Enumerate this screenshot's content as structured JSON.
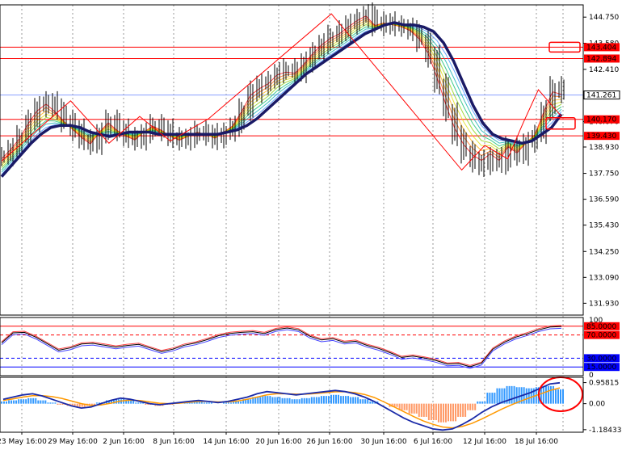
{
  "chart_data": {
    "type": "line",
    "title": "",
    "x_labels": [
      "23 May 16:00",
      "29 May 16:00",
      "2 Jun 16:00",
      "8 Jun 16:00",
      "14 Jun 16:00",
      "20 Jun 16:00",
      "26 Jun 16:00",
      "30 Jun 16:00",
      "6 Jul 16:00",
      "12 Jul 16:00",
      "18 Jul 16:00"
    ],
    "price_panel": {
      "ylim": [
        131.4,
        145.3
      ],
      "tick_labels": [
        "144.750",
        "143.580",
        "142.410",
        "141.240",
        "140.070",
        "138.930",
        "137.750",
        "136.590",
        "135.430",
        "134.250",
        "133.090",
        "131.930"
      ],
      "ticks": [
        144.75,
        143.58,
        142.41,
        141.24,
        140.07,
        138.93,
        137.75,
        136.59,
        135.43,
        134.25,
        133.09,
        131.93
      ],
      "level_lines": [
        {
          "value": 143.404,
          "label": "143.404",
          "color": "#ff0000"
        },
        {
          "value": 142.894,
          "label": "142.894",
          "color": "#ff0000"
        },
        {
          "value": 140.17,
          "label": "140.170",
          "color": "#ff0000"
        },
        {
          "value": 139.43,
          "label": "139.430",
          "color": "#ff0000"
        }
      ],
      "current_price": {
        "value": 141.261,
        "label": "141.261"
      },
      "close_series": [
        138.5,
        138.9,
        139.4,
        140.1,
        140.7,
        141.0,
        140.6,
        140.1,
        139.7,
        139.3,
        139.0,
        139.6,
        140.1,
        139.7,
        139.4,
        139.2,
        139.6,
        139.9,
        139.7,
        139.4,
        139.2,
        139.4,
        139.6,
        139.5,
        139.3,
        139.6,
        139.9,
        140.6,
        141.4,
        141.7,
        141.9,
        142.3,
        142.4,
        142.3,
        142.7,
        143.2,
        143.6,
        143.9,
        144.1,
        144.4,
        144.7,
        144.9,
        144.4,
        144.5,
        144.4,
        144.3,
        144.1,
        143.7,
        143.0,
        141.8,
        140.5,
        139.4,
        138.7,
        138.3,
        138.1,
        138.5,
        138.2,
        138.9,
        138.6,
        139.1,
        139.5,
        140.6,
        141.6,
        141.4
      ],
      "slow_ma_series": [
        137.6,
        138.1,
        138.6,
        139.1,
        139.5,
        139.8,
        139.9,
        139.9,
        139.8,
        139.6,
        139.5,
        139.4,
        139.5,
        139.6,
        139.6,
        139.6,
        139.5,
        139.5,
        139.5,
        139.5,
        139.5,
        139.5,
        139.5,
        139.6,
        139.7,
        139.9,
        140.2,
        140.6,
        141.0,
        141.4,
        141.8,
        142.2,
        142.5,
        142.8,
        143.1,
        143.4,
        143.7,
        144.0,
        144.2,
        144.4,
        144.5,
        144.4,
        144.4,
        144.3,
        144.1,
        143.6,
        142.8,
        141.8,
        140.8,
        140.0,
        139.5,
        139.3,
        139.2,
        139.1,
        139.2,
        139.5,
        139.8,
        140.4
      ]
    },
    "rsi_panel": {
      "ylim": [
        0,
        100
      ],
      "tick_labels": [
        "100",
        "85.0000",
        "70.0000",
        "30.0000",
        "15.0000",
        "0"
      ],
      "levels": [
        {
          "value": 85,
          "label": "85.0000",
          "color": "#ff0000"
        },
        {
          "value": 70,
          "label": "70.0000",
          "color": "#ff0000"
        },
        {
          "value": 30,
          "label": "30.0000",
          "color": "#0000ff"
        },
        {
          "value": 15,
          "label": "15.0000",
          "color": "#0000ff"
        }
      ],
      "series": [
        60,
        70,
        72,
        65,
        55,
        45,
        50,
        58,
        52,
        50,
        48,
        52,
        55,
        50,
        45,
        42,
        50,
        55,
        62,
        70,
        75,
        78,
        72,
        70,
        78,
        82,
        80,
        70,
        65,
        60,
        55,
        58,
        52,
        48,
        42,
        35,
        30,
        28,
        25,
        20,
        22,
        18,
        25,
        42,
        55,
        65,
        72,
        80,
        86,
        88
      ]
    },
    "macd_panel": {
      "ylim": [
        -1.3,
        1.2
      ],
      "tick_labels": [
        "0.95815",
        "0.00",
        "-1.18433"
      ],
      "ticks": [
        0.95815,
        0,
        -1.18433
      ],
      "histogram": [
        0.1,
        0.15,
        0.2,
        0.25,
        0.15,
        0.05,
        -0.05,
        -0.1,
        -0.15,
        -0.1,
        0.05,
        0.15,
        0.2,
        0.15,
        0.05,
        -0.05,
        -0.1,
        -0.05,
        0,
        0.05,
        0.1,
        0.05,
        0,
        0.05,
        0.1,
        0.2,
        0.3,
        0.35,
        0.3,
        0.25,
        0.2,
        0.25,
        0.3,
        0.35,
        0.4,
        0.35,
        0.3,
        0.2,
        0.1,
        0,
        -0.15,
        -0.3,
        -0.45,
        -0.6,
        -0.75,
        -0.85,
        -0.8,
        -0.6,
        -0.3,
        0.1,
        0.5,
        0.7,
        0.8,
        0.75,
        0.7,
        0.75,
        0.8,
        0.65
      ],
      "macd_line": [
        0.2,
        0.3,
        0.4,
        0.45,
        0.35,
        0.2,
        0.05,
        -0.1,
        -0.2,
        -0.15,
        0,
        0.15,
        0.25,
        0.2,
        0.1,
        0,
        -0.05,
        0,
        0.05,
        0.1,
        0.15,
        0.1,
        0.05,
        0.1,
        0.2,
        0.3,
        0.45,
        0.55,
        0.5,
        0.45,
        0.4,
        0.45,
        0.5,
        0.55,
        0.6,
        0.55,
        0.45,
        0.3,
        0.1,
        -0.15,
        -0.4,
        -0.65,
        -0.85,
        -1.0,
        -1.15,
        -1.2,
        -1.15,
        -0.95,
        -0.7,
        -0.4,
        -0.15,
        0.05,
        0.2,
        0.35,
        0.5,
        0.7,
        0.9,
        0.95
      ],
      "signal_line": [
        0.15,
        0.22,
        0.3,
        0.36,
        0.36,
        0.32,
        0.24,
        0.12,
        0.0,
        -0.08,
        -0.06,
        0.02,
        0.12,
        0.16,
        0.14,
        0.08,
        0.02,
        0.0,
        0.02,
        0.06,
        0.1,
        0.1,
        0.08,
        0.08,
        0.12,
        0.2,
        0.3,
        0.4,
        0.45,
        0.45,
        0.43,
        0.43,
        0.46,
        0.5,
        0.54,
        0.55,
        0.5,
        0.42,
        0.28,
        0.08,
        -0.14,
        -0.36,
        -0.58,
        -0.78,
        -0.94,
        -1.06,
        -1.1,
        -1.04,
        -0.9,
        -0.7,
        -0.48,
        -0.26,
        -0.06,
        0.12,
        0.28,
        0.44,
        0.6,
        0.72
      ]
    }
  },
  "colors": {
    "price_bars": "#000000",
    "bull_pivot_line": "#ff0000",
    "slow_ma": "#1a1a66",
    "rsi_main": "#000000",
    "rsi_signal_red": "#ff4444",
    "rsi_signal_blue": "#4444ff",
    "macd_hist_pos": "#3399ff",
    "macd_hist_neg": "#ff9966",
    "macd_line": "#1a2aa8",
    "signal_line": "#ff9900",
    "grid": "#999999"
  }
}
